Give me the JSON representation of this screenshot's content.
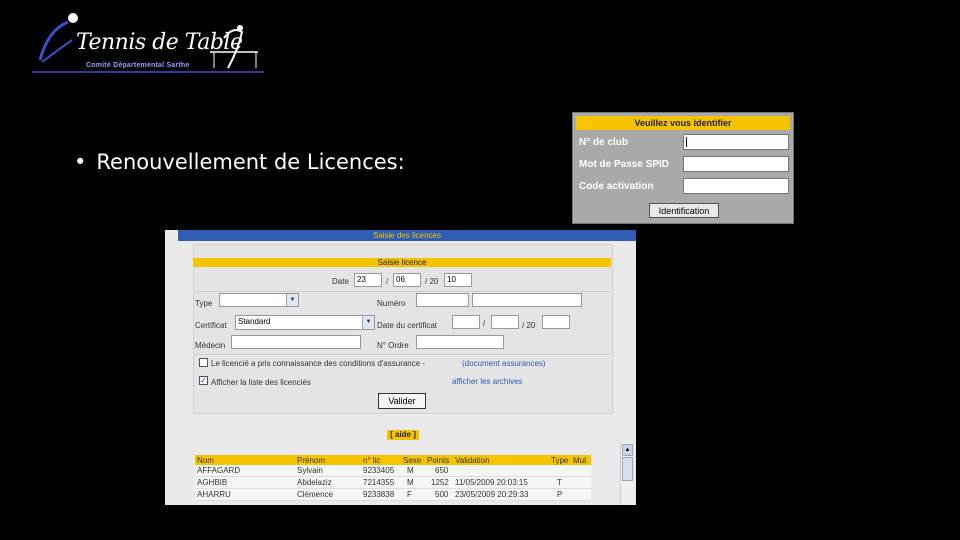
{
  "logo": {
    "title": "Tennis de Table",
    "subtitle": "Comité Départemental Sarthe"
  },
  "bullet": {
    "symbol": "•",
    "text": "Renouvellement de Licences:"
  },
  "login": {
    "header": "Veuillez vous identifier",
    "club_label": "N° de club",
    "password_label": "Mot de Passe SPID",
    "activation_label": "Code activation",
    "button_label": "Identification"
  },
  "form": {
    "title": "Saisie des licences",
    "section_header": "Saisie licence",
    "date_label": "Date",
    "date_day": "23",
    "date_month": "06",
    "date_sep": "/",
    "date_year_prefix": "/ 20",
    "date_year": "10",
    "type_label": "Type",
    "numero_label": "Numéro",
    "certificat_label": "Certificat",
    "certificat_value": "Standard",
    "date_certificat_label": "Date du certificat",
    "date_certificat_year_prefix": "/ 20",
    "medecin_label": "Médecin",
    "no_ordre_label": "N° Ordre",
    "assurance_text": "Le licencié a pris connaissance des conditions d'assurance -",
    "assurance_link": "(document assurances)",
    "afficher_liste": "Afficher la liste des licenciés",
    "afficher_archives": "afficher les archives",
    "valider_button": "Valider",
    "aide": "[ aide ]"
  },
  "table": {
    "headers": [
      "Nom",
      "Prénom",
      "n° lic",
      "Sexe",
      "Points",
      "Validation",
      "Type",
      "Mut"
    ],
    "rows": [
      [
        "AFFAGARD",
        "Sylvain",
        "9233405",
        "M",
        "650",
        "",
        "",
        ""
      ],
      [
        "AGHBIB",
        "Abdelaziz",
        "7214355",
        "M",
        "1252",
        "11/05/2009 20:03:15",
        "T",
        ""
      ],
      [
        "AHARRU",
        "Clémence",
        "9233838",
        "F",
        "500",
        "23/05/2009 20:29:33",
        "P",
        ""
      ]
    ]
  }
}
